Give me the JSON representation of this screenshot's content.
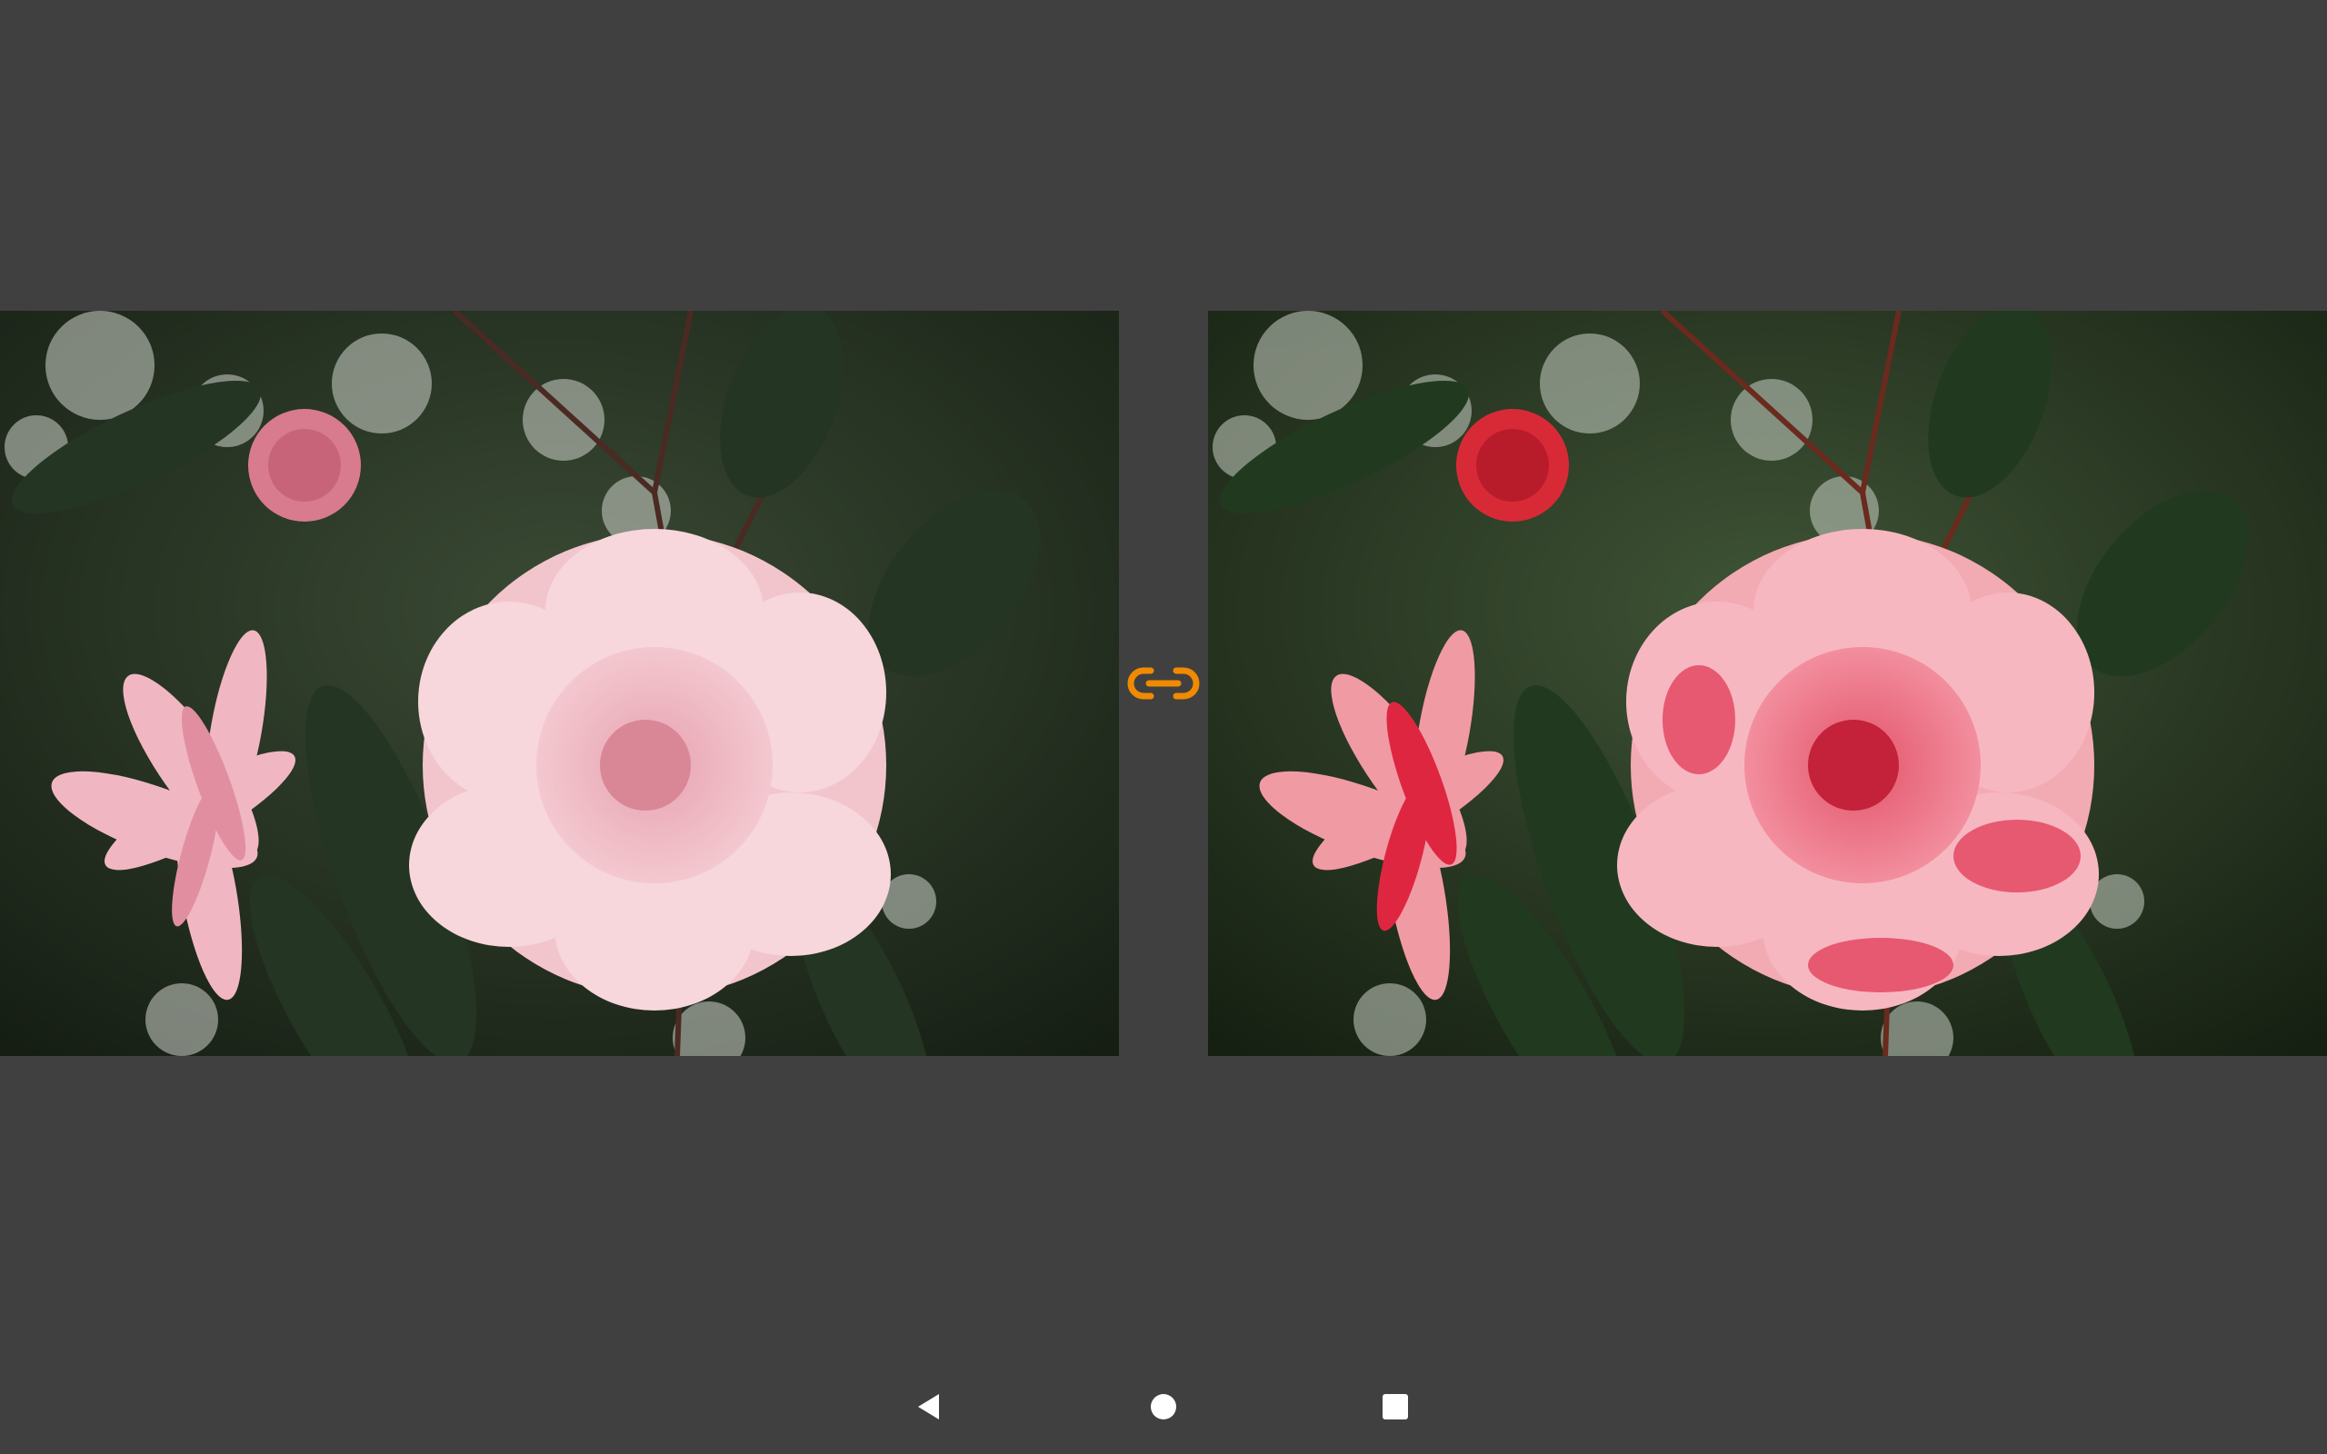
{
  "compare": {
    "left_image": "original-camellia-photo",
    "right_image": "edited-camellia-photo",
    "link_icon": "link-icon",
    "accent_color": "#f39c12"
  },
  "navigation_bar": {
    "back": "back-icon",
    "home": "home-icon",
    "recents": "recents-icon"
  }
}
